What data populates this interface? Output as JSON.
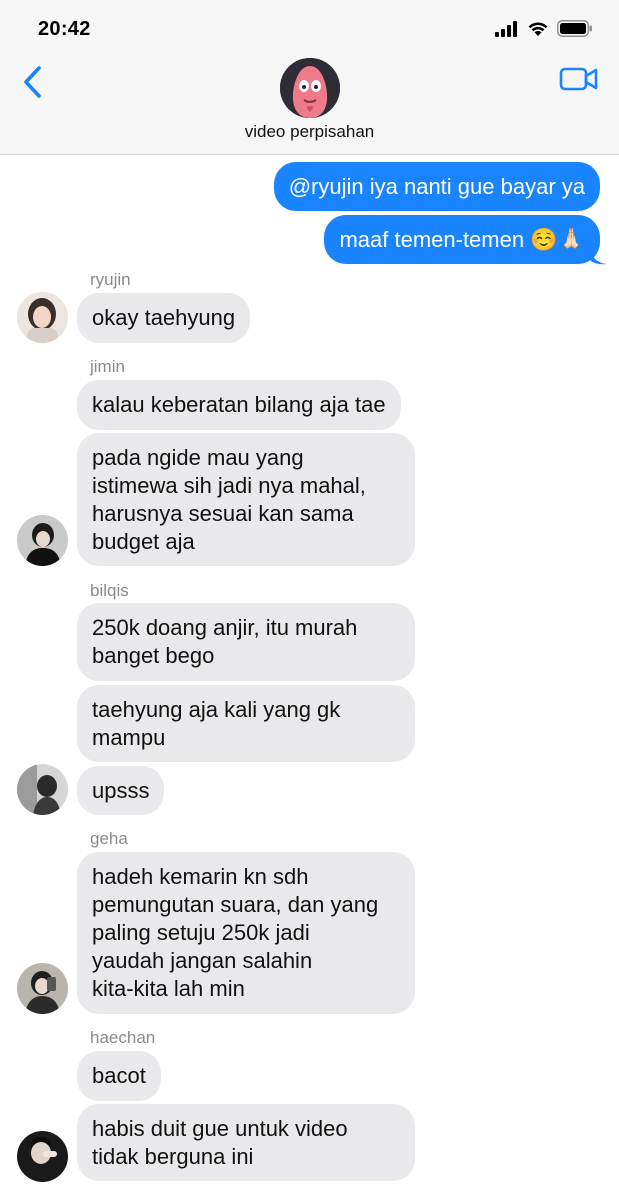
{
  "status_bar": {
    "time": "20:42"
  },
  "header": {
    "title": "video perpisahan"
  },
  "messages": {
    "out1": "@ryujin iya nanti gue bayar ya",
    "out2": "maaf temen-temen ☺️🙏🏻",
    "ryujin_name": "ryujin",
    "ryujin_1": "okay taehyung",
    "jimin_name": "jimin",
    "jimin_1": "kalau keberatan bilang aja tae",
    "jimin_2": "pada ngide mau yang\nistimewa sih jadi nya mahal,\nharusnya sesuai kan sama\nbudget aja",
    "bilqis_name": "bilqis",
    "bilqis_1": "250k doang anjir, itu murah\nbanget bego",
    "bilqis_2": "taehyung aja kali yang gk\nmampu",
    "bilqis_3": "upsss",
    "geha_name": "geha",
    "geha_1": "hadeh kemarin kn sdh\npemungutan suara, dan yang\npaling setuju 250k jadi\nyaudah jangan salahin\nkita-kita lah min",
    "haechan_name": "haechan",
    "haechan_1": "bacot",
    "haechan_2": "habis duit gue untuk video\ntidak berguna ini"
  },
  "colors": {
    "outgoing": "#1a84ff",
    "incoming": "#e9e9eb",
    "accent": "#1a84ff"
  },
  "icons": [
    "signal-icon",
    "wifi-icon",
    "battery-icon",
    "back-chevron-icon",
    "video-call-icon"
  ]
}
